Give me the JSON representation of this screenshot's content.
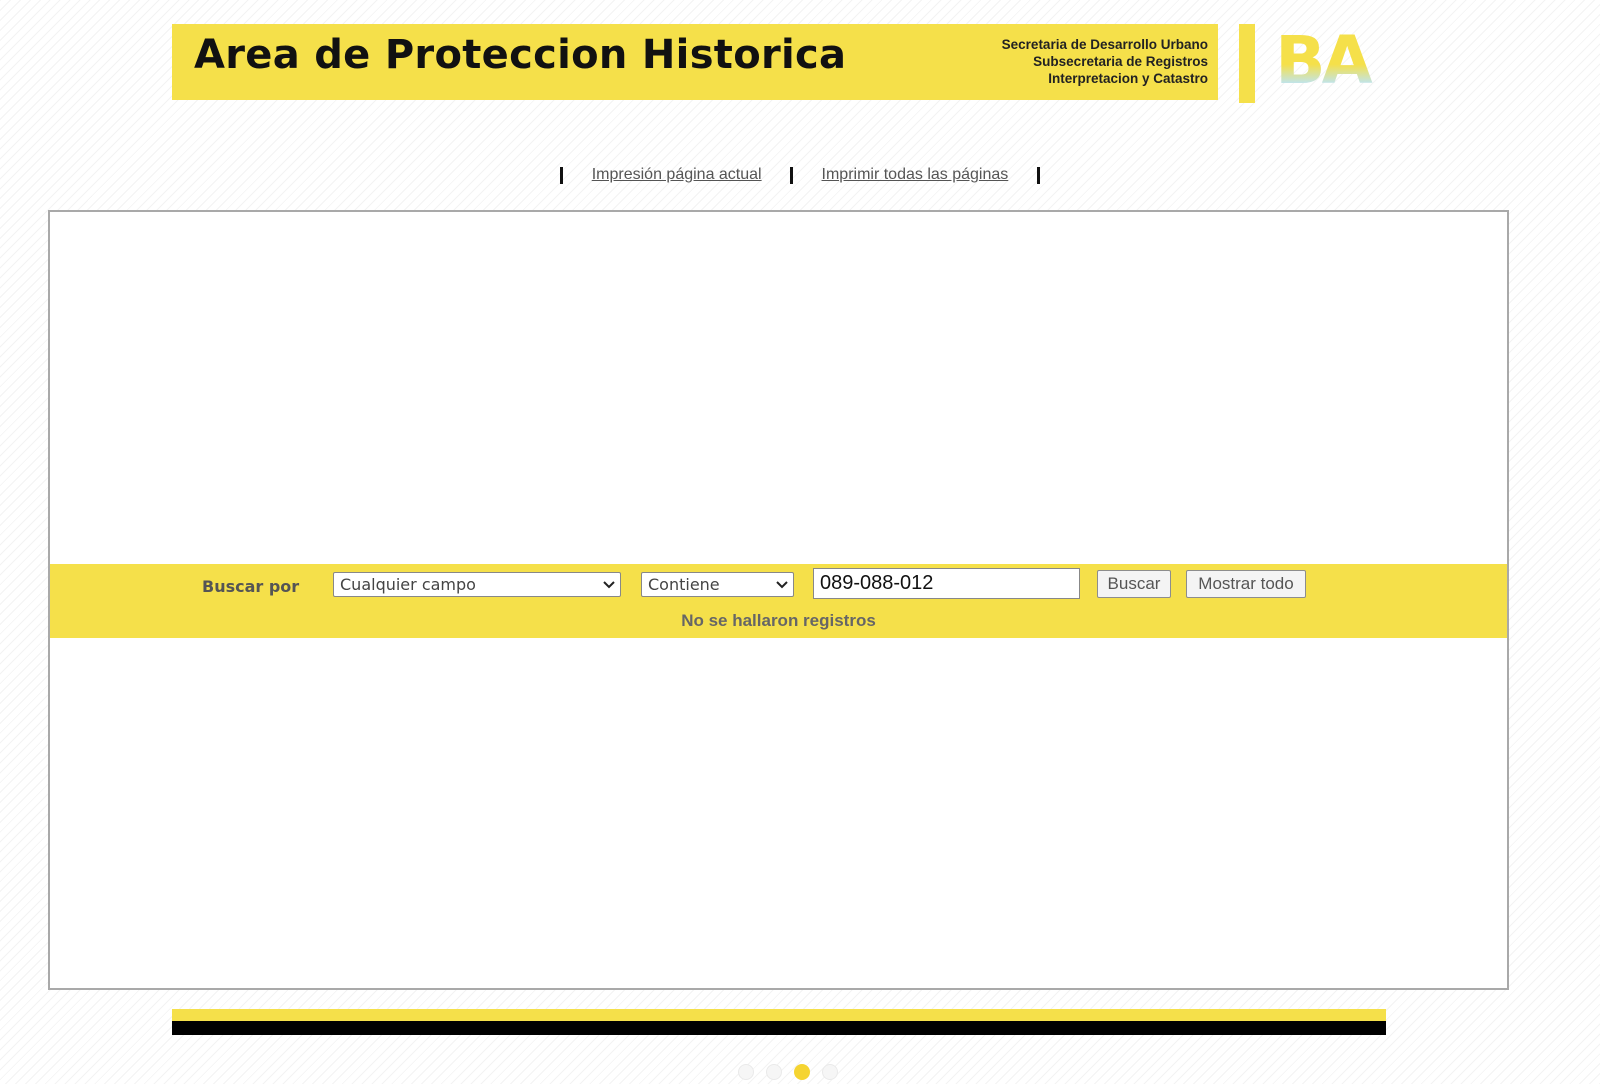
{
  "header": {
    "title": "Area de Proteccion Historica",
    "department_lines": [
      "Secretaria de Desarrollo Urbano",
      "Subsecretaria de Registros",
      "Interpretacion y Catastro"
    ],
    "logo_text": "BA",
    "accent_color": "#f5e04a"
  },
  "print_links": {
    "current_page": "Impresión página actual",
    "all_pages": "Imprimir todas las páginas"
  },
  "search": {
    "label": "Buscar por",
    "field_select": "Cualquier campo",
    "operator_select": "Contiene",
    "query": "089-088-012",
    "search_button": "Buscar",
    "show_all_button": "Mostrar todo",
    "result_message": "No se hallaron registros"
  },
  "carousel": {
    "dot_count": 4,
    "active_index": 2
  }
}
